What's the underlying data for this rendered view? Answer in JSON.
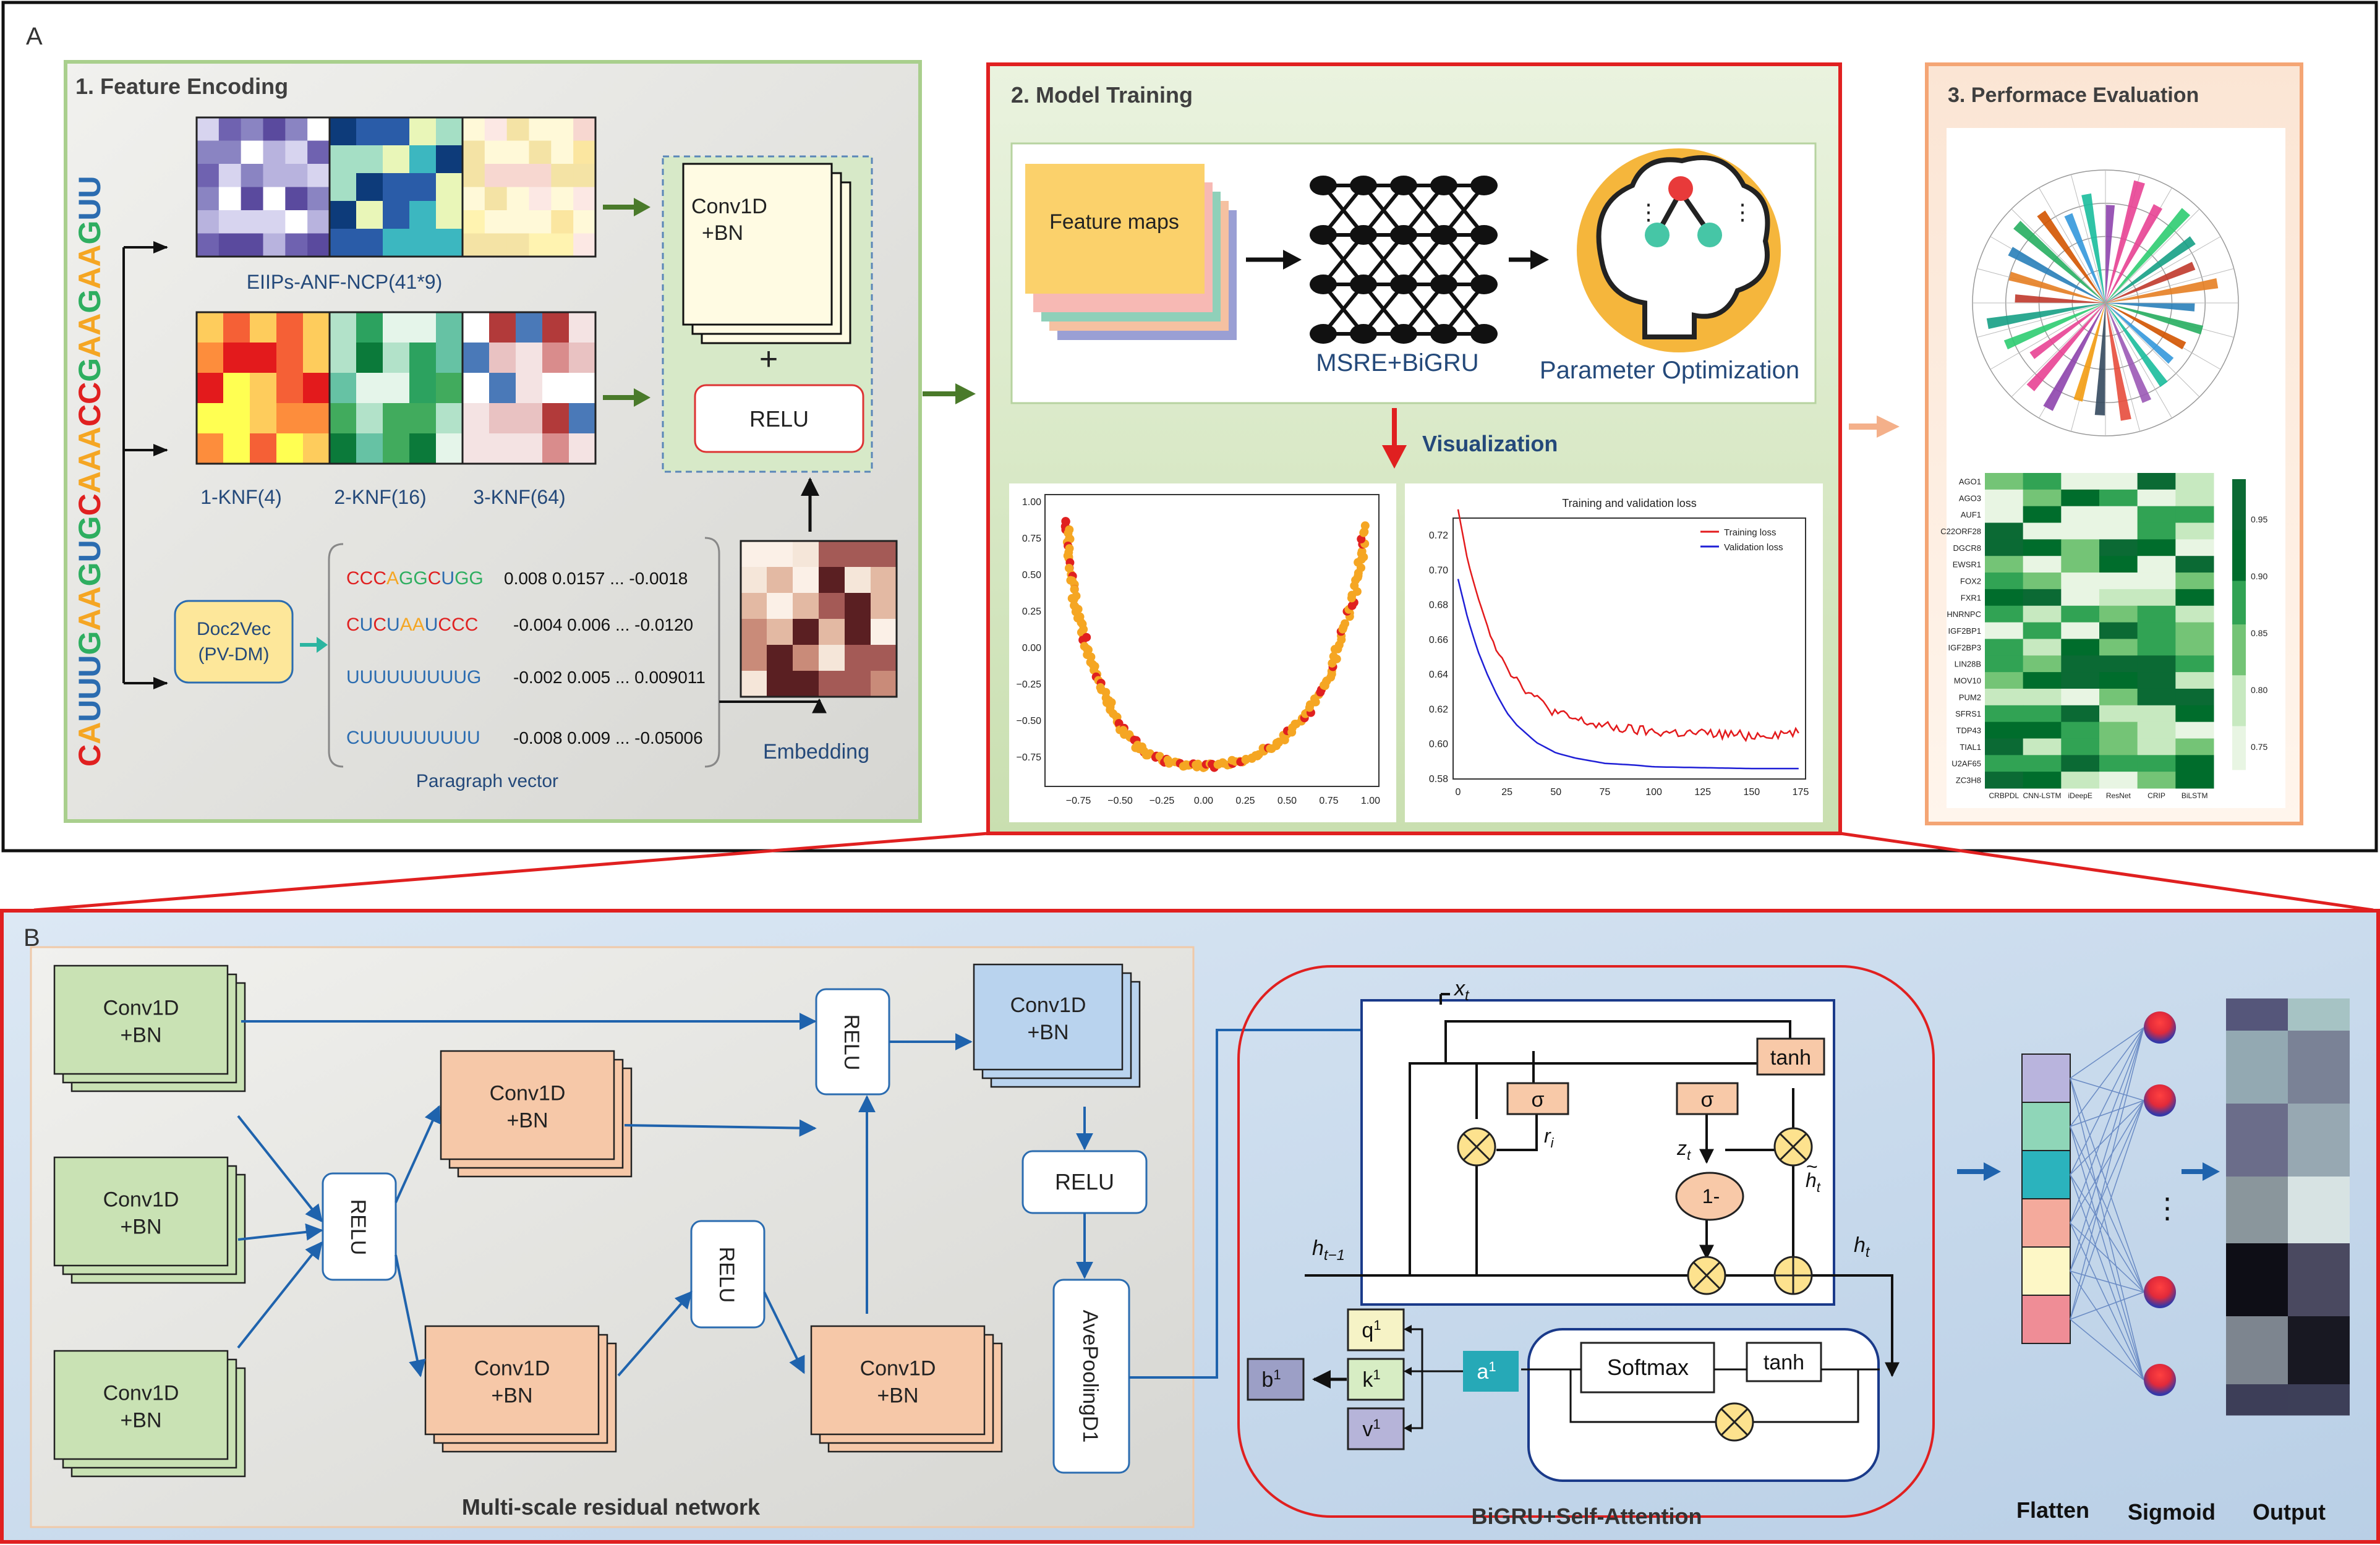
{
  "panel_a": {
    "tag": "A",
    "sequence": "CAUUUGAAGUGCAAACCGAAGAAGUU",
    "feature_encoding": {
      "title": "1. Feature Encoding",
      "eiip_label": "EIIPs-ANF-NCP(41*9)",
      "knf_labels": [
        "1-KNF(4)",
        "2-KNF(16)",
        "3-KNF(64)"
      ],
      "doc2vec_label": [
        "Doc2Vec",
        "(PV-DM)"
      ],
      "kmers": [
        "CCCAGGCUGG",
        "CUCUAAUCCC",
        "UUUUUUUUUG",
        "CUUUUUUUUU"
      ],
      "vectors": [
        "0.008 0.0157 ... -0.0018",
        "-0.004 0.006 ... -0.0120",
        "-0.002 0.005 ... 0.009011",
        "-0.008 0.009 ... -0.05006"
      ],
      "paragraph_label": "Paragraph vector",
      "embedding_label": "Embedding",
      "conv_label": [
        "Conv1D",
        "+BN"
      ],
      "plus_label": "+",
      "relu_label": "RELU"
    },
    "model_training": {
      "title": "2. Model Training",
      "feature_maps_label": "Feature maps",
      "msre_label": "MSRE+BiGRU",
      "param_label": "Parameter Optimization",
      "visualization_label": "Visualization"
    },
    "performance": {
      "title": "3. Performace Evaluation"
    }
  },
  "panel_b": {
    "tag": "B",
    "conv_label": [
      "Conv1D",
      "+BN"
    ],
    "relu_label": "RELU",
    "avepool_label": "AvePoolingD1",
    "msrn_label": "Multi-scale residual network",
    "bigru_label": "BiGRU+Self-Attention",
    "gru": {
      "xt": "x",
      "xt_sub": "t",
      "sigma": "σ",
      "tanh": "tanh",
      "r": "r",
      "r_sub": "i",
      "z": "z",
      "z_sub": "t",
      "one_minus": "1-",
      "htilde": "h",
      "htilde_sub": "t",
      "hprev": "h",
      "hprev_sub": "t−1",
      "ht": "h",
      "ht_sub": "t"
    },
    "attention": {
      "q": "q",
      "k": "k",
      "v": "v",
      "b": "b",
      "a": "a",
      "sup": "1",
      "softmax": "Softmax",
      "tanh": "tanh"
    },
    "flatten_label": "Flatten",
    "sigmoid_label": "Sigmoid",
    "output_label": "Output",
    "dots": "⋮"
  },
  "chart_data": [
    {
      "type": "line",
      "title": "Training and validation loss",
      "xlabel": "",
      "ylabel": "",
      "xlim": [
        0,
        175
      ],
      "ylim": [
        0.58,
        0.73
      ],
      "x_ticks": [
        0,
        25,
        50,
        75,
        100,
        125,
        150,
        175
      ],
      "y_ticks": [
        0.58,
        0.6,
        0.62,
        0.64,
        0.66,
        0.68,
        0.7,
        0.72
      ],
      "legend_position": "top-right",
      "series": [
        {
          "name": "Training loss",
          "color": "#e31a1c",
          "x": [
            0,
            5,
            10,
            15,
            20,
            25,
            30,
            40,
            50,
            60,
            75,
            90,
            100,
            125,
            150,
            175
          ],
          "y": [
            0.735,
            0.705,
            0.685,
            0.668,
            0.655,
            0.645,
            0.637,
            0.626,
            0.618,
            0.614,
            0.61,
            0.608,
            0.607,
            0.606,
            0.605,
            0.607
          ]
        },
        {
          "name": "Validation loss",
          "color": "#1f1fd6",
          "x": [
            0,
            5,
            10,
            15,
            20,
            25,
            30,
            40,
            50,
            60,
            75,
            90,
            100,
            125,
            150,
            175
          ],
          "y": [
            0.695,
            0.672,
            0.654,
            0.64,
            0.628,
            0.618,
            0.611,
            0.601,
            0.595,
            0.592,
            0.589,
            0.588,
            0.587,
            0.5865,
            0.586,
            0.586
          ]
        }
      ]
    },
    {
      "type": "scatter",
      "title": "",
      "xlim": [
        -0.95,
        1.05
      ],
      "ylim": [
        -0.95,
        1.05
      ],
      "x_ticks": [
        -0.75,
        -0.5,
        -0.25,
        0.0,
        0.25,
        0.5,
        0.75,
        1.0
      ],
      "y_ticks": [
        -0.75,
        -0.5,
        -0.25,
        0.0,
        0.25,
        0.5,
        0.75,
        1.0
      ],
      "x_tick_labels": [
        "−0.75",
        "−0.50",
        "−0.25",
        "0.00",
        "0.25",
        "0.50",
        "0.75",
        "1.00"
      ],
      "y_tick_labels": [
        "−0.75",
        "−0.50",
        "−0.25",
        "0.00",
        "0.25",
        "0.50",
        "0.75",
        "1.00"
      ],
      "curve": [
        [
          -0.82,
          0.88
        ],
        [
          -0.8,
          0.6
        ],
        [
          -0.77,
          0.3
        ],
        [
          -0.7,
          0.0
        ],
        [
          -0.6,
          -0.3
        ],
        [
          -0.5,
          -0.55
        ],
        [
          -0.35,
          -0.72
        ],
        [
          -0.15,
          -0.8
        ],
        [
          0.05,
          -0.81
        ],
        [
          0.25,
          -0.77
        ],
        [
          0.45,
          -0.65
        ],
        [
          0.62,
          -0.45
        ],
        [
          0.75,
          -0.2
        ],
        [
          0.85,
          0.15
        ],
        [
          0.93,
          0.5
        ],
        [
          0.97,
          0.85
        ]
      ],
      "series_colors": [
        "#f5a623",
        "#e02020"
      ]
    },
    {
      "type": "heatmap",
      "rows": [
        "AGO1",
        "AGO3",
        "AUF1",
        "C22ORF28",
        "DGCR8",
        "EWSR1",
        "FOX2",
        "FXR1",
        "HNRNPC",
        "IGF2BP1",
        "IGF2BP3",
        "LIN28B",
        "MOV10",
        "PUM2",
        "SFRS1",
        "TDP43",
        "TIAL1",
        "U2AF65",
        "ZC3H8"
      ],
      "columns": [
        "CRBPDL",
        "CNN-LSTM",
        "iDeepE",
        "ResNet",
        "CRIP",
        "BiLSTM"
      ],
      "colorbar_ticks": [
        "0.95",
        "0.90",
        "0.85",
        "0.80",
        "0.75"
      ]
    }
  ]
}
